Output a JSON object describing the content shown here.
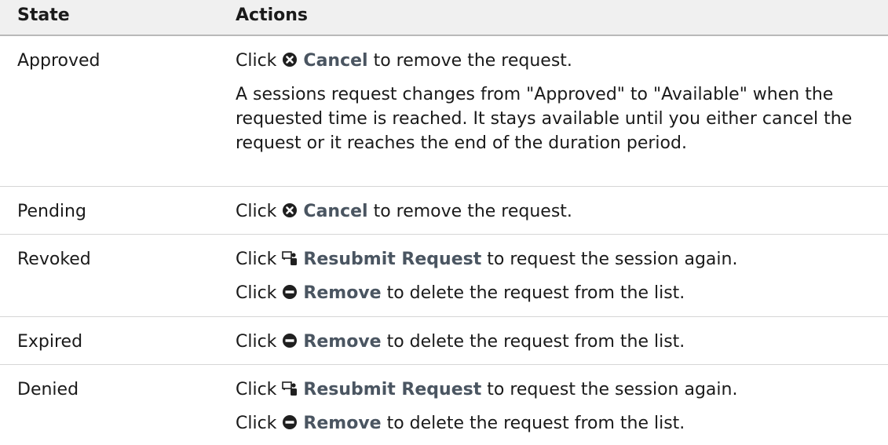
{
  "header": {
    "state": "State",
    "actions": "Actions"
  },
  "text": {
    "click": "Click",
    "cancel": "Cancel",
    "cancel_tail": "to remove the request.",
    "resubmit": "Resubmit Request",
    "resubmit_tail": "to request the session again.",
    "remove": "Remove",
    "remove_tail": "to delete the request from the list.",
    "approved_note": "A sessions request changes from \"Approved\" to \"Available\" when the requested time is reached. It stays available until you either cancel the request or it reaches the end of the duration period."
  },
  "rows": [
    {
      "state": "Approved"
    },
    {
      "state": "Pending"
    },
    {
      "state": "Revoked"
    },
    {
      "state": "Expired"
    },
    {
      "state": "Denied"
    }
  ],
  "icons": {
    "cancel": "cancel-circle-x-icon",
    "resubmit": "resubmit-request-icon",
    "remove": "remove-minus-circle-icon"
  }
}
